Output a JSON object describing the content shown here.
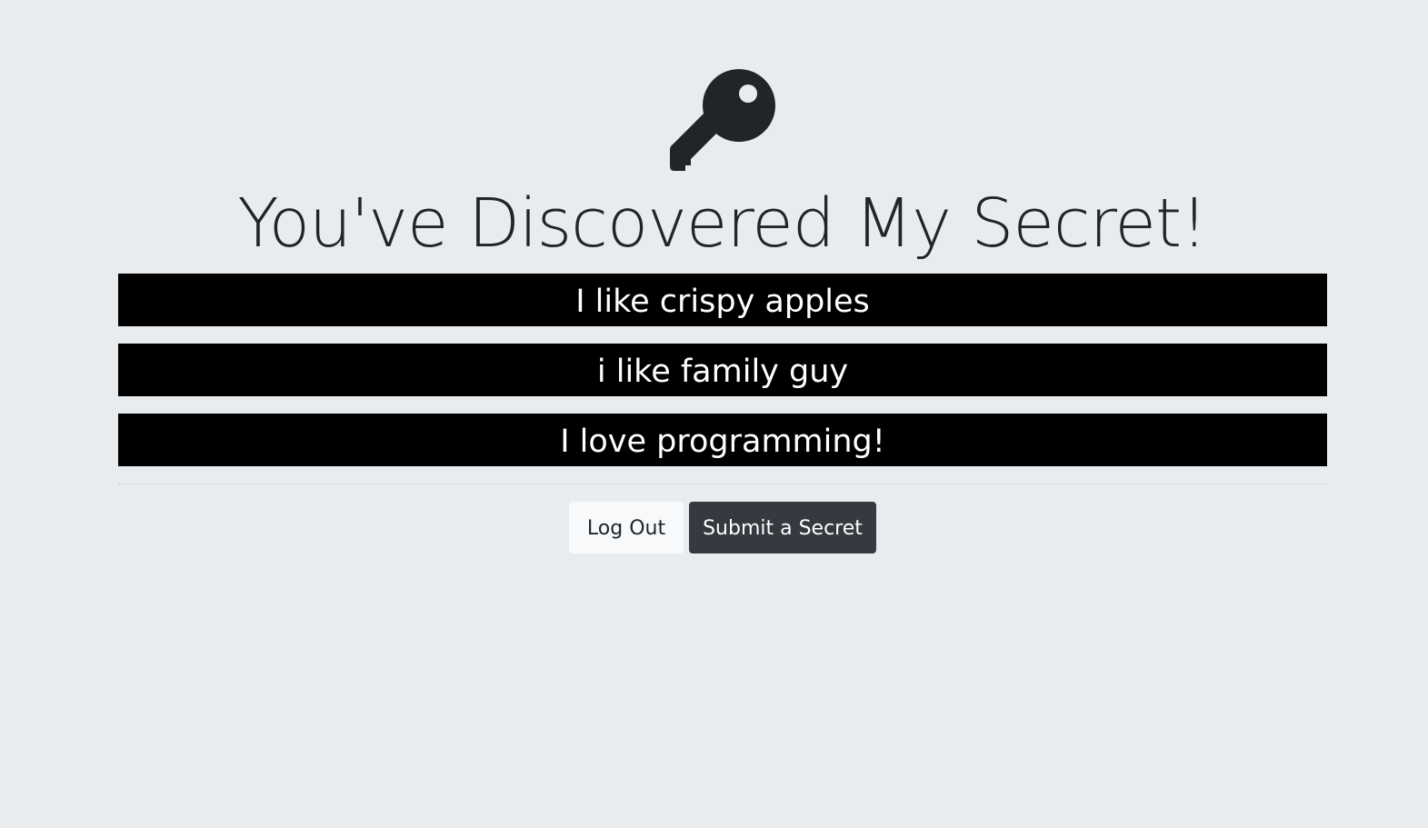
{
  "header": {
    "icon": "key-icon",
    "title": "You've Discovered My Secret!"
  },
  "secrets": [
    "I like crispy apples",
    "i like family guy",
    "I love programming!"
  ],
  "actions": {
    "logout_label": "Log Out",
    "submit_label": "Submit a Secret"
  },
  "colors": {
    "background": "#e9ecef",
    "secret_bg": "#000000",
    "secret_text": "#ffffff",
    "icon": "#212529",
    "button_dark": "#343a40",
    "button_light": "#f8f9fa"
  }
}
